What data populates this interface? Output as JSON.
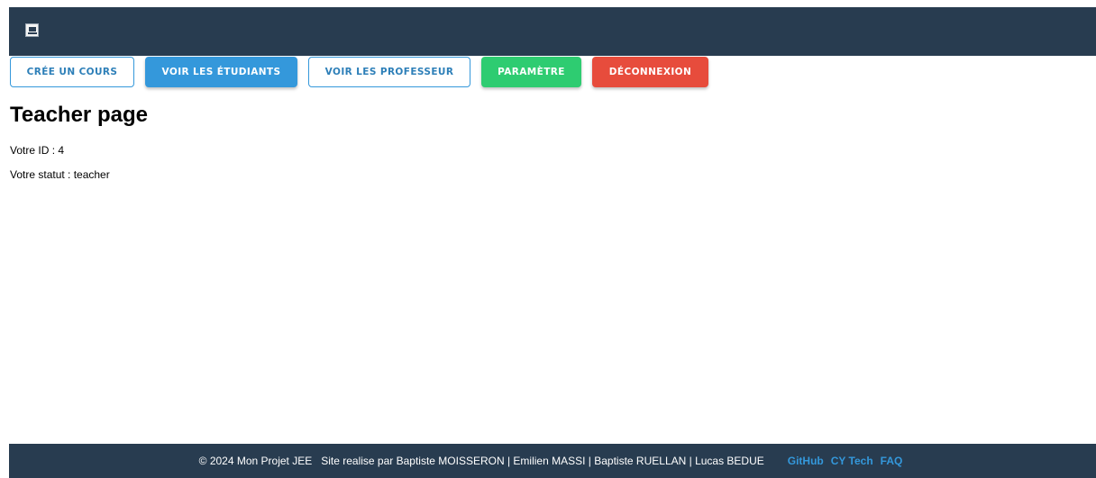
{
  "header": {
    "logo_icon": "book-logo-icon"
  },
  "nav": {
    "create_course": "Crée un cours",
    "view_students": "Voir les étudiants",
    "view_teachers": "Voir les professeur",
    "settings": "Paramètre",
    "logout": "Déconnexion"
  },
  "main": {
    "title": "Teacher page",
    "id_line": "Votre ID : 4",
    "status_line": "Votre statut : teacher"
  },
  "footer": {
    "copyright": "© 2024 Mon Projet JEE",
    "credits": "Site realise par Baptiste MOISSERON | Emilien MASSI | Baptiste RUELLAN | Lucas BEDUE",
    "links": [
      "GitHub",
      "CY Tech",
      "FAQ"
    ]
  },
  "colors": {
    "header_bg": "#283c50",
    "primary_blue": "#3498db",
    "success_green": "#2ecc71",
    "danger_red": "#e74c3c"
  }
}
